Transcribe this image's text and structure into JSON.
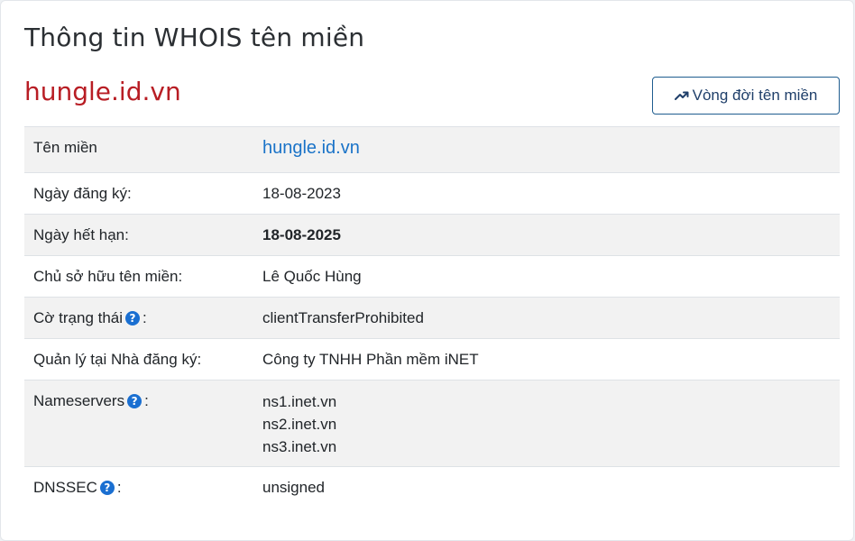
{
  "page": {
    "title": "Thông tin WHOIS tên miền",
    "domain_heading": "hungle.id.vn"
  },
  "toolbar": {
    "lifecycle_button_label": "Vòng đời tên miền",
    "lifecycle_icon": "trending-up-icon"
  },
  "colors": {
    "domain_heading": "#b81d24",
    "link": "#1a73c8",
    "button_border": "#1f5d8f",
    "help_icon": "#1a6fd1",
    "striped_row": "#f2f2f2"
  },
  "whois": {
    "domain": {
      "label": "Tên miền",
      "value": "hungle.id.vn"
    },
    "registered": {
      "label": "Ngày đăng ký:",
      "value": "18-08-2023"
    },
    "expires": {
      "label": "Ngày hết hạn:",
      "value": "18-08-2025"
    },
    "owner": {
      "label": "Chủ sở hữu tên miền:",
      "value": "Lê Quốc Hùng"
    },
    "status": {
      "label": "Cờ trạng thái",
      "suffix": ":",
      "value": "clientTransferProhibited",
      "help_icon": "question-circle-icon"
    },
    "registrar": {
      "label": "Quản lý tại Nhà đăng ký:",
      "value": "Công ty TNHH Phần mềm iNET"
    },
    "nameservers": {
      "label": "Nameservers",
      "suffix": ":",
      "values": [
        "ns1.inet.vn",
        "ns2.inet.vn",
        "ns3.inet.vn"
      ],
      "help_icon": "question-circle-icon"
    },
    "dnssec": {
      "label": "DNSSEC",
      "suffix": ":",
      "value": "unsigned",
      "help_icon": "question-circle-icon"
    }
  }
}
